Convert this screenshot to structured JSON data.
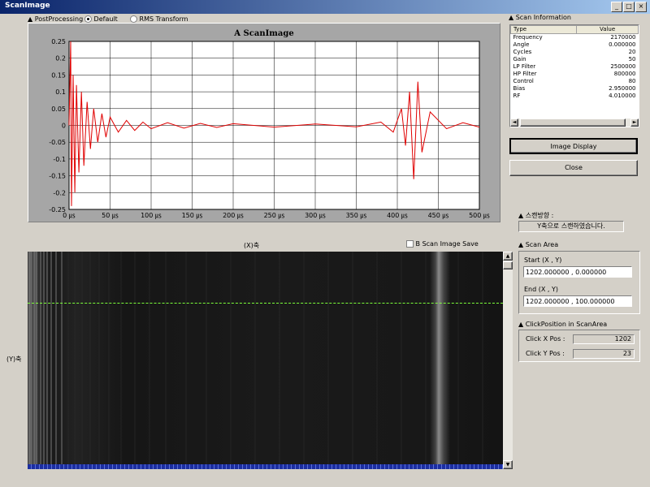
{
  "window": {
    "title": "ScanImage"
  },
  "options": {
    "group_label": "PostProcessing",
    "default_label": "Default",
    "rms_label": "RMS Transform",
    "selected": "Default"
  },
  "chart_data": {
    "type": "line",
    "title": "A ScanImage",
    "x_tick_labels": [
      "0 ㎲",
      "50 ㎲",
      "100 ㎲",
      "150 ㎲",
      "200 ㎲",
      "250 ㎲",
      "300 ㎲",
      "350 ㎲",
      "400 ㎲",
      "450 ㎲",
      "500 ㎲"
    ],
    "y_tick_labels": [
      "0.25",
      "0.2",
      "0.15",
      "0.1",
      "0.05",
      "0",
      "-0.05",
      "-0.1",
      "-0.15",
      "-0.2",
      "-0.25"
    ],
    "xlim": [
      0,
      500
    ],
    "ylim": [
      -0.25,
      0.25
    ],
    "grid": true,
    "series": [
      {
        "color": "#e00000",
        "x": [
          0,
          2,
          3,
          5,
          7,
          9,
          12,
          15,
          18,
          22,
          26,
          30,
          35,
          40,
          45,
          50,
          60,
          70,
          80,
          90,
          100,
          120,
          140,
          160,
          180,
          200,
          250,
          300,
          350,
          380,
          395,
          405,
          410,
          415,
          420,
          425,
          430,
          440,
          460,
          480,
          500
        ],
        "y": [
          0,
          0.25,
          -0.24,
          0.15,
          -0.2,
          0.12,
          -0.14,
          0.1,
          -0.12,
          0.07,
          -0.07,
          0.05,
          -0.05,
          0.035,
          -0.035,
          0.025,
          -0.02,
          0.015,
          -0.015,
          0.01,
          -0.01,
          0.008,
          -0.008,
          0.006,
          -0.006,
          0.005,
          -0.005,
          0.004,
          -0.004,
          0.01,
          -0.02,
          0.05,
          -0.06,
          0.1,
          -0.16,
          0.13,
          -0.08,
          0.04,
          -0.01,
          0.008,
          -0.005
        ]
      }
    ]
  },
  "bscan": {
    "x_label": "(X)축",
    "y_label": "(Y)축",
    "save_label": "B Scan Image Save"
  },
  "scan_info": {
    "section_label": "Scan Information",
    "col_type": "Type",
    "col_value": "Value",
    "rows": [
      {
        "type": "Frequency",
        "value": "2170000"
      },
      {
        "type": "Angle",
        "value": "0.000000"
      },
      {
        "type": "Cycles",
        "value": "20"
      },
      {
        "type": "Gain",
        "value": "50"
      },
      {
        "type": "LP Filter",
        "value": "2500000"
      },
      {
        "type": "HP Filter",
        "value": "800000"
      },
      {
        "type": "Control",
        "value": "80"
      },
      {
        "type": "Bias",
        "value": "2.950000"
      },
      {
        "type": "RF",
        "value": "4.010000"
      }
    ]
  },
  "buttons": {
    "image_display": "Image Display",
    "close": "Close"
  },
  "scan_direction": {
    "label": "스캔방향 :",
    "value": "Y축으로 스캔하였습니다."
  },
  "scan_area": {
    "label": "Scan Area",
    "start_label": "Start (X , Y)",
    "start_value": "1202.000000 , 0.000000",
    "end_label": "End   (X , Y)",
    "end_value": "1202.000000 , 100.000000"
  },
  "click_position": {
    "label": "ClickPosition in ScanArea",
    "x_label": "Click X Pos :",
    "x_value": "1202",
    "y_label": "Click Y Pos :",
    "y_value": "23"
  }
}
